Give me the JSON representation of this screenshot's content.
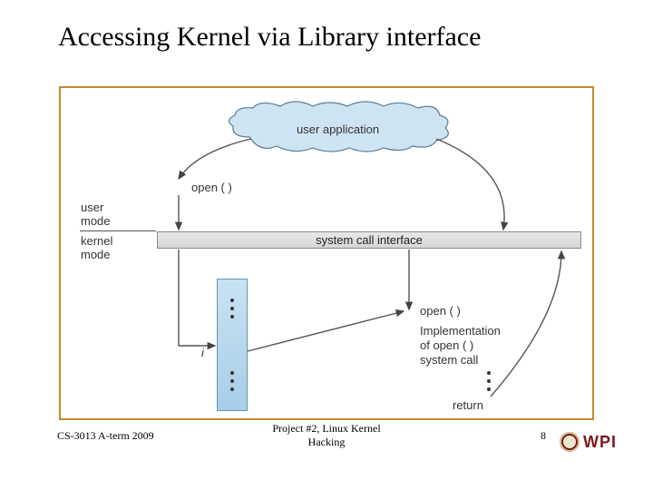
{
  "title": "Accessing Kernel via Library interface",
  "diagram": {
    "cloud_label": "user application",
    "open_top": "open ( )",
    "user_mode": "user\nmode",
    "kernel_mode": "kernel\nmode",
    "sci_label": "system call interface",
    "index_label": "i",
    "open_bottom": "open ( )",
    "impl_text": "Implementation\nof open ( )\nsystem call",
    "return_label": "return"
  },
  "footer": {
    "left": "CS-3013 A-term 2009",
    "center": "Project #2, Linux Kernel\nHacking",
    "page": "8",
    "logo_text": "WPI"
  }
}
